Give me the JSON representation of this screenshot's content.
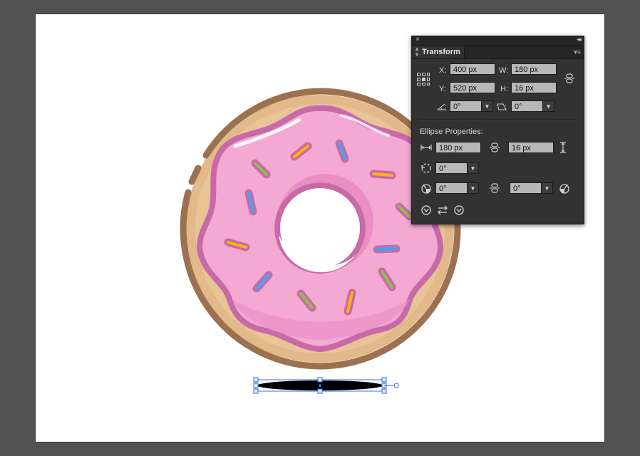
{
  "panel": {
    "tab_label": "Transform",
    "close_glyph": "×",
    "collapse_glyph": "◂◂",
    "menu_glyph": "▾≡",
    "x_label": "X:",
    "x_value": "400 px",
    "y_label": "Y:",
    "y_value": "520 px",
    "w_label": "W:",
    "w_value": "180 px",
    "h_label": "H:",
    "h_value": "16 px",
    "rotate_value": "0°",
    "shear_value": "0°",
    "section_title": "Ellipse Properties:",
    "ellipse_width": "180 px",
    "ellipse_height": "16 px",
    "pie_rotation": "0°",
    "pie_start": "0°",
    "pie_end": "0°"
  },
  "colors": {
    "canvas_bg": "#535353",
    "artboard": "#ffffff",
    "panel_bg": "#323232",
    "field_bg": "#b8b8b8",
    "selection": "#2e6fe8",
    "donut_outline": "#9c7150",
    "dough": "#e2b98a",
    "icing": "#f4a9d3",
    "icing_outline": "#c869a8"
  },
  "icons": [
    "reference-point-icon",
    "constrain-link-icon",
    "rotate-angle-icon",
    "shear-angle-icon",
    "width-icon",
    "height-icon",
    "pie-rotation-icon",
    "pie-start-icon",
    "pie-end-icon",
    "swap-icon"
  ]
}
